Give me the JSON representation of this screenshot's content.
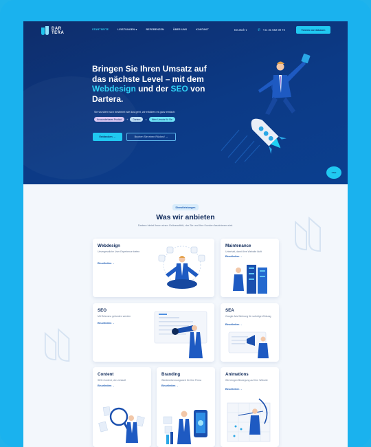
{
  "logo": {
    "line1": "DAR",
    "line2": "TERA"
  },
  "nav": {
    "items": [
      {
        "label": "STARTSEITE",
        "active": true
      },
      {
        "label": "LEISTUNGEN ▾",
        "active": false
      },
      {
        "label": "REFERENZEN",
        "active": false
      },
      {
        "label": "ÜBER UNS",
        "active": false
      },
      {
        "label": "KONTAKT",
        "active": false
      }
    ],
    "language": "Deutsch ▾",
    "phone": "+41 31 552 00 72",
    "cta": "Termin vereinbaren"
  },
  "hero": {
    "title_1": "Bringen Sie Ihren Umsatz auf das nächste Level – mit dem ",
    "title_hl1": "Webdesign",
    "title_2": " und der ",
    "title_hl2": "SEO",
    "title_3": " von Dartera.",
    "subtitle": "Sie wundern sich bestimmt wie das geht, wir erklären es ganz einfach:",
    "tag1": "Ihr wunderbares Produkt",
    "tag2": "Dartera",
    "tag3": "Mehr Umsatz für Sie",
    "sep1": "+",
    "sep2": "=",
    "primary_button": "Entdecken →",
    "secondary_button": "Buchen Sie einen Rückruf →",
    "chat_label": "Chat"
  },
  "services": {
    "badge": "Dienstleistungen",
    "title": "Was wir anbieten",
    "subtitle": "Dartera bietet Ihnen einen Onlineauftritt, der Sie und Ihre Kunden faszinieren wird.",
    "cards": [
      {
        "title": "Webdesign",
        "desc": "Unvergessliche User Experience bieten",
        "more": "Einzelheiten →"
      },
      {
        "title": "Maintenance",
        "desc": "Unterhalt, damit Ihre Website läuft",
        "more": "Einzelheiten →"
      },
      {
        "title": "SEO",
        "desc": "Mit Relevanz gefunden werden",
        "more": "Einzelheiten →"
      },
      {
        "title": "SEA",
        "desc": "Google Ads Werbung für sofortige Wirkung",
        "more": "Einzelheiten →"
      },
      {
        "title": "Content",
        "desc": "SEO-Content, der verkauft",
        "more": "Einzelheiten →"
      },
      {
        "title": "Branding",
        "desc": "Wiedererkennungswert für Ihre Firma",
        "more": "Einzelheiten →"
      },
      {
        "title": "Animations",
        "desc": "Wir bringen Bewegung auf Ihre Website",
        "more": "Einzelheiten →"
      }
    ]
  },
  "colors": {
    "primary": "#0c3a86",
    "accent": "#20c9f1",
    "frame": "#1ab2ee",
    "text_dark": "#0f2a5a"
  }
}
